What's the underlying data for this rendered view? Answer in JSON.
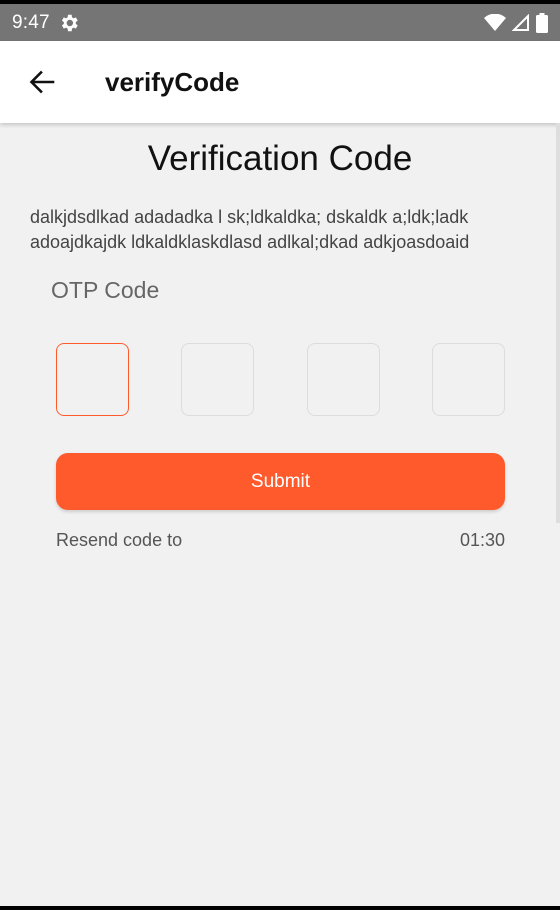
{
  "status_bar": {
    "time": "9:47",
    "icons": [
      "settings-gear-icon",
      "wifi-icon",
      "signal-icon",
      "battery-icon"
    ]
  },
  "app_bar": {
    "back_icon": "arrow-left-icon",
    "title": "verifyCode"
  },
  "main": {
    "heading": "Verification Code",
    "description": "dalkjdsdlkad adadadka l sk;ldkaldka; dskaldk a;ldk;ladk adoajdkajdk ldkaldklaskdlasd adlkal;dkad adkjoasdoaid",
    "otp_label": "OTP Code",
    "otp_boxes": [
      "",
      "",
      "",
      ""
    ],
    "submit_label": "Submit",
    "resend_text": "Resend code to",
    "timer": "01:30"
  },
  "colors": {
    "accent": "#ff5a2c",
    "status_bar": "#757575",
    "background": "#f1f1f1"
  }
}
